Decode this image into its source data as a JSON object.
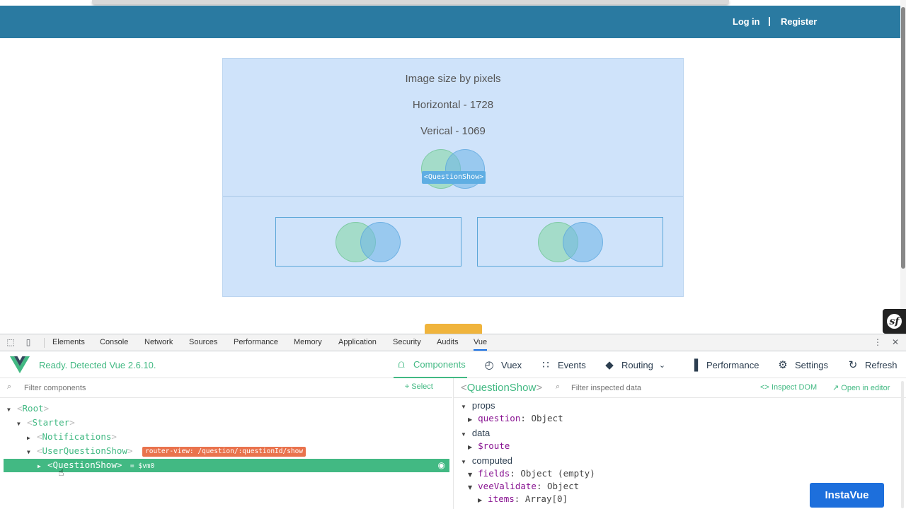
{
  "site": {
    "login": "Log in",
    "separator": "|",
    "register": "Register"
  },
  "card": {
    "line1": "Image size by pixels",
    "line2": "Horizontal - 1728",
    "line3": "Verical - 1069",
    "component_tag": "<QuestionShow>"
  },
  "devtools": {
    "tabs": [
      "Elements",
      "Console",
      "Network",
      "Sources",
      "Performance",
      "Memory",
      "Application",
      "Security",
      "Audits",
      "Vue"
    ],
    "active_tab": "Vue"
  },
  "vue": {
    "ready": "Ready. Detected Vue 2.6.10.",
    "nav": {
      "components": "Components",
      "vuex": "Vuex",
      "events": "Events",
      "routing": "Routing",
      "performance": "Performance",
      "settings": "Settings",
      "refresh": "Refresh"
    },
    "filter_components_placeholder": "Filter components",
    "select": "Select",
    "tree": {
      "root": "Root",
      "starter": "Starter",
      "notifications": "Notifications",
      "user_question_show": "UserQuestionShow",
      "router_badge": "router-view: /question/:questionId/show",
      "question_show": "QuestionShow",
      "vm_ref": "= $vm0"
    },
    "inspector": {
      "component": "QuestionShow",
      "filter_placeholder": "Filter inspected data",
      "inspect_dom": "Inspect DOM",
      "open_in_editor": "Open in editor",
      "props_label": "props",
      "question_key": "question",
      "question_val": "Object",
      "data_label": "data",
      "route_key": "$route",
      "computed_label": "computed",
      "fields_key": "fields",
      "fields_val": "Object (empty)",
      "vee_key": "veeValidate",
      "vee_val": "Object",
      "items_key": "items",
      "items_val": "Array[0]"
    }
  },
  "instavue": "InstaVue",
  "colors": {
    "header": "#2a7aa1",
    "vue_green": "#42b983",
    "card_bg": "#cfe3fa",
    "instavue": "#1d6fdc"
  }
}
